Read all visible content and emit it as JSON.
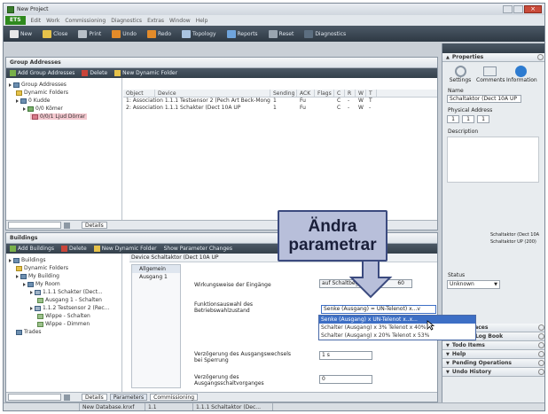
{
  "window": {
    "title": "New Project"
  },
  "menubar": {
    "ets_label": "ETS",
    "items": [
      "Edit",
      "Work",
      "Commissioning",
      "Diagnostics",
      "Extras",
      "Window",
      "Help"
    ]
  },
  "toolbar": {
    "items": [
      "New",
      "Close",
      "Print",
      "Undo",
      "Redo",
      "Topology",
      "Reports",
      "Reset",
      "Diagnostics"
    ]
  },
  "group_addresses": {
    "title": "Group Addresses",
    "bar": [
      "Add Group Addresses",
      "Delete",
      "New Dynamic Folder"
    ],
    "tree": [
      "Group Addresses",
      "Dynamic Folders",
      "0 Kudde",
      "0/0 Kömer",
      "0/0/1 Ljud Dörrar"
    ],
    "columns": [
      "Object",
      "Device",
      "Sending",
      "ACK",
      "Flags",
      "C",
      "R",
      "W",
      "T"
    ],
    "rows": [
      [
        "1: Association 1.1.1 Testsensor 2 (Pech Art Beck-Mongelle)",
        "1",
        "Fu",
        "C",
        "-",
        "W",
        "T"
      ],
      [
        "2: Association 1.1.1 Schakter (Dect 10A UP",
        "1",
        "Fu",
        "C",
        "-",
        "W",
        "-"
      ]
    ],
    "tab": "Details"
  },
  "buildings": {
    "title": "Buildings",
    "bar": [
      "Add Buildings",
      "Delete",
      "New Dynamic Folder",
      "Show Parameter Changes"
    ],
    "tree": [
      "Buildings",
      "Dynamic Folders",
      "My Building",
      "My Room",
      "1.1.1 Schakter (Dect...",
      "Ausgang 1 - Schalten",
      "1.1.2 Testsensor 2 (Rec...",
      "Wippe - Schalten",
      "Wippe - Dimmen",
      "Trades"
    ],
    "device_header": "Device Schaltaktor (Dect 10A UP",
    "param_tabs": [
      "Allgemein",
      "Ausgang 1"
    ],
    "params": [
      {
        "label": "Wirkungsweise der Eingänge",
        "value": "auf Schaltbegrenzung",
        "value_extra": "60"
      },
      {
        "label": "Funktionsauswahl des Betriebswahlzustand",
        "value": "Senke (Ausgang) = UN-Telenot) x...v"
      },
      {
        "label": "Verzögerung des Ausgangswechsels bei Sperrung",
        "value": "1 s"
      },
      {
        "label": "Verzögerung des Ausgangsschaltvorganges",
        "value": "0"
      }
    ],
    "dropdown_options": [
      "Senke (Ausgang) x UN-Telenot x..x...",
      "Schalter (Ausgang) x 3% Telenot x 40%",
      "Schalter (Ausgang) x 20% Telenot x 53%"
    ],
    "tabs": [
      "Details",
      "Parameters",
      "Commissioning"
    ]
  },
  "properties": {
    "title": "Properties",
    "tabs": [
      "Settings",
      "Comments",
      "Information"
    ],
    "name_label": "Name",
    "name_value": "Schaltaktor (Dect 10A UP",
    "address_label": "Physical Address",
    "address_parts": [
      "1",
      "1",
      "1"
    ],
    "description_label": "Description",
    "status_label": "Status",
    "status_value": "Unknown",
    "side_notes": [
      "Schaltaktor (Dect 10A",
      "Schaltaktor UP (200)"
    ],
    "sections": [
      "Workspaces",
      "Project Log Book",
      "Todo Items",
      "Help",
      "Pending Operations",
      "Undo History"
    ]
  },
  "callout": {
    "line1": "Ändra",
    "line2": "parametrar"
  },
  "status_bar": {
    "items": [
      "New Database.knxf",
      "1.1",
      "1.1.1 Schaltaktor (Dec..."
    ]
  }
}
